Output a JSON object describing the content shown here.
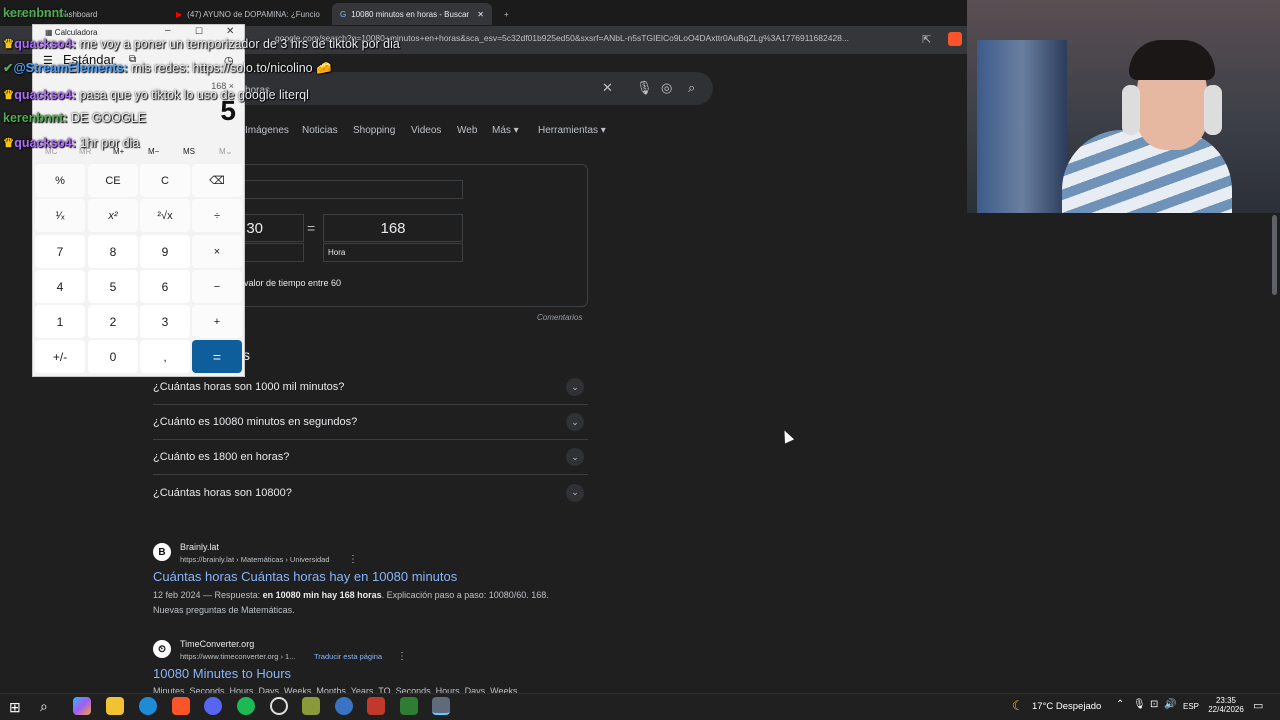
{
  "browser": {
    "tabs": [
      {
        "label": "Stream - Kick Dashboard"
      },
      {
        "label": "(47) AYUNO de DOPAMINA: ¿Funcio"
      },
      {
        "label": "10080 minutos en horas - Buscar"
      }
    ],
    "address": "google.com/search?q=10080+minutos+en+horas&sca_esv=5c32df01b925ed50&sxsrf=ANbL-n5sTGIElCo9LoO4DAxttr0AuBqZLg%3A1776911682428..."
  },
  "search": {
    "value": "horas",
    "tabs": [
      "Imágenes",
      "Noticias",
      "Shopping",
      "Videos",
      "Web",
      "Más",
      "Herramientas"
    ]
  },
  "converter": {
    "from_value": "10080",
    "from_value_visible": "30",
    "equals": "=",
    "to_value": "168",
    "to_unit": "Hora",
    "formula_note": "valor de tiempo entre 60",
    "feedback": "Comentarios"
  },
  "faq": {
    "heading_tail": "s",
    "items": [
      "¿Cuántas horas son 1000 mil minutos?",
      "¿Cuánto es 10080 minutos en segundos?",
      "¿Cuánto es 1800 en horas?",
      "¿Cuántas horas son 10800?"
    ]
  },
  "results": [
    {
      "site": "Brainly.lat",
      "url": "https://brainly.lat › Matemáticas › Universidad",
      "title": "Cuántas horas Cuántas horas hay en 10080 minutos",
      "snippet_date": "12 feb 2024 — Respuesta: ",
      "snippet_bold": "en 10080 min hay 168 horas",
      "snippet_rest": ". Explicación paso a paso: 10080/60. 168.",
      "snippet_line2": "Nuevas preguntas de Matemáticas.",
      "icon": "B"
    },
    {
      "site": "TimeConverter.org",
      "url": "https://www.timeconverter.org › 1...",
      "translate": "Traducir esta página",
      "title": "10080 Minutes to Hours",
      "snippet": "Minutes, Seconds, Hours, Days, Weeks, Months, Years, TO, Seconds, Hours, Days, Weeks,",
      "icon": "⏲"
    }
  ],
  "chat": [
    {
      "user": "kerenbnnt:",
      "msg": ""
    },
    {
      "user": "quackso4:",
      "msg": "me voy a poner un temporizador de 3 hrs de tiktok por dia"
    },
    {
      "user": "@StreamElements:",
      "msg": "mis redes: https://solo.to/nicolino 🧀"
    },
    {
      "user": "quackso4:",
      "msg": "pasa que yo tiktok lo uso de google literql"
    },
    {
      "user": "kerenbnnt:",
      "msg": "DE GOOGLE"
    },
    {
      "user": "quackso4:",
      "msg": "1hr por dia"
    }
  ],
  "calculator": {
    "title": "Calculadora",
    "mode": "Estándar",
    "expression": "168 ×",
    "display": "5",
    "memory": [
      "MC",
      "MR",
      "M+",
      "M−",
      "MS",
      "M⌄"
    ],
    "keys": [
      [
        "%",
        "CE",
        "C",
        "⌫"
      ],
      [
        "¹⁄ₓ",
        "x²",
        "²√x",
        "÷"
      ],
      [
        "7",
        "8",
        "9",
        "×"
      ],
      [
        "4",
        "5",
        "6",
        "−"
      ],
      [
        "1",
        "2",
        "3",
        "+"
      ],
      [
        "+/-",
        "0",
        ",",
        "="
      ]
    ]
  },
  "taskbar": {
    "weather": "17°C  Despejado",
    "lang": "ESP",
    "time": "23:35",
    "date": "22/4/2026"
  }
}
